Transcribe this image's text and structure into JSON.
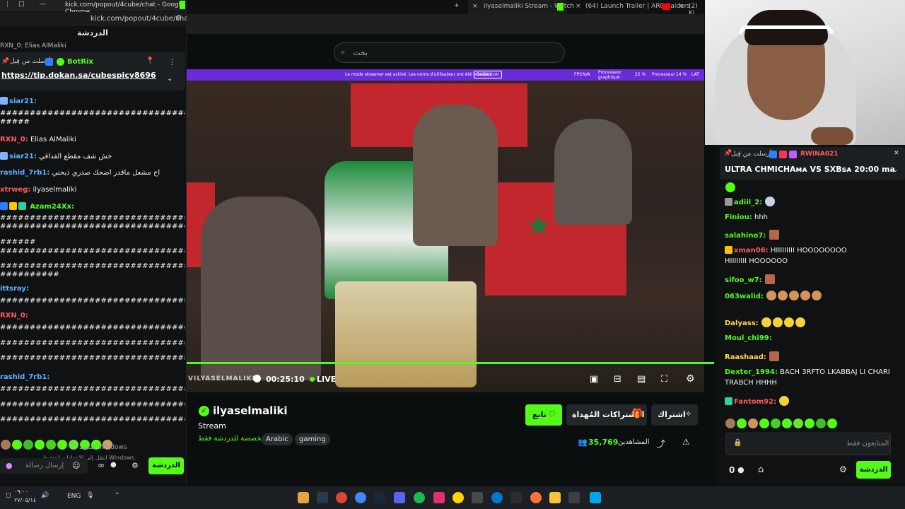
{
  "popout": {
    "window_title": "kick.com/popout/4cube/chat - Google Chrome",
    "url": "kick.com/popout/4cube/chat",
    "header": "الدردشة",
    "top_user": "RXN_0: Elias AlMaliki",
    "pinned_sender": "أرسلت من قِبل",
    "pinned_user": "BotRix",
    "pinned_link": "https://tip.dokan.sa/cubespicy8696",
    "messages": [
      {
        "user": "siar21:",
        "text": "",
        "color": "b"
      },
      {
        "user": "",
        "text": "######################################",
        "color": ""
      },
      {
        "user": "RXN_0:",
        "text": "Elias AlMaliki",
        "color": "r"
      },
      {
        "user": "siar21:",
        "text": "خش شف مقطع الفداقي",
        "color": "b"
      },
      {
        "user": "rashid_7rb1:",
        "text": "اح مشعل ماقدر اضحك صدري ذبحني",
        "color": "b"
      },
      {
        "user": "xtrweg:",
        "text": "ilyaselmaliki",
        "color": "r"
      },
      {
        "user": "Azam24Xx:",
        "text": "",
        "color": "g"
      },
      {
        "user": "ittsray:",
        "text": "",
        "color": "b"
      },
      {
        "user": "RXN_0:",
        "text": "",
        "color": "r"
      },
      {
        "user": "rashid_7rb1:",
        "text": "",
        "color": "b"
      }
    ],
    "windows_note_1": "تنشيط Windows",
    "windows_note_2": "انتقل إلى الإعدادات لتنشيط Windows.",
    "input_placeholder": "إرسال رسالة",
    "chat_button": "الدردشة"
  },
  "tabs": [
    {
      "label": "ilyaselmaliki Stream - Watch"
    },
    {
      "label": "(64) Launch Trailer | ARC Raiders"
    },
    {
      "label": "(2) Ki"
    }
  ],
  "search": {
    "placeholder": "بحث"
  },
  "streamer_bar": {
    "text": "Le mode streamer est activé. Les noms d'utilisateur ont été brouillés.",
    "button": "Désactiver",
    "fps_label": "FPS",
    "fps_value": "N/A",
    "proc_label": "Processeur graphique",
    "proc_value": "22 %",
    "cpu_label": "Processeur",
    "cpu_value": "14 %",
    "lat_label": "LAT"
  },
  "video": {
    "time": "00:25:10",
    "live": "LIVE",
    "watermark": "VILYASELMALIKI",
    "progress": 1.0
  },
  "channel": {
    "name": "ilyaselmaliki",
    "category": "Stream",
    "tag_ar": "مخصصة للدردشة فقط",
    "tags": [
      "Arabic",
      "gaming"
    ],
    "follow": "تابع",
    "gift_subs": "الاشتراكات المُهداة",
    "subscribe": "اشتراك",
    "viewers_label": "المشاهدين",
    "viewers_value": "35,769"
  },
  "right_chat": {
    "pinned_sender": "أرسلت من قِبل",
    "pinned_user": "RWINA021",
    "pinned_text": "ULTRA CHMICHAᴍᴀ VS SXBsᴀ 20:00 ma",
    "messages": [
      {
        "user": "adiil_2:",
        "text": "",
        "color": "g"
      },
      {
        "user": "Finiou:",
        "text": "hhh",
        "color": "g"
      },
      {
        "user": "salahino7:",
        "text": "",
        "color": "g"
      },
      {
        "user": "xman06:",
        "text": "HIIIIIIIII  HOOOOOOOO",
        "color": "r"
      },
      {
        "user": "",
        "text": "HIIIIIIII  HOOOOOO",
        "color": ""
      },
      {
        "user": "sifoo_w7:",
        "text": "",
        "color": "g"
      },
      {
        "user": "063walid:",
        "text": "",
        "color": "g"
      },
      {
        "user": "Dalyass:",
        "text": "",
        "color": "y"
      },
      {
        "user": "Moul_chi99:",
        "text": "",
        "color": "g"
      },
      {
        "user": "Raashaad:",
        "text": "",
        "color": "y"
      },
      {
        "user": "Dexter_1994:",
        "text": "BACH 3RFTO LKABBAJ LI CHARI",
        "color": "g"
      },
      {
        "user": "",
        "text": "TRABCH HHHH",
        "color": ""
      },
      {
        "user": "Fantom92:",
        "text": "",
        "color": "r"
      }
    ],
    "input_placeholder": "المتابعون فقط",
    "points": "0",
    "chat_button": "الدردشة"
  },
  "taskbar": {
    "time": "۰۹:۰۰",
    "date": "۲۷/۰۵/۱٤",
    "lang": "ENG"
  },
  "colors": {
    "kick_green": "#53fc18",
    "streamer_purple": "#6c2bd9"
  }
}
